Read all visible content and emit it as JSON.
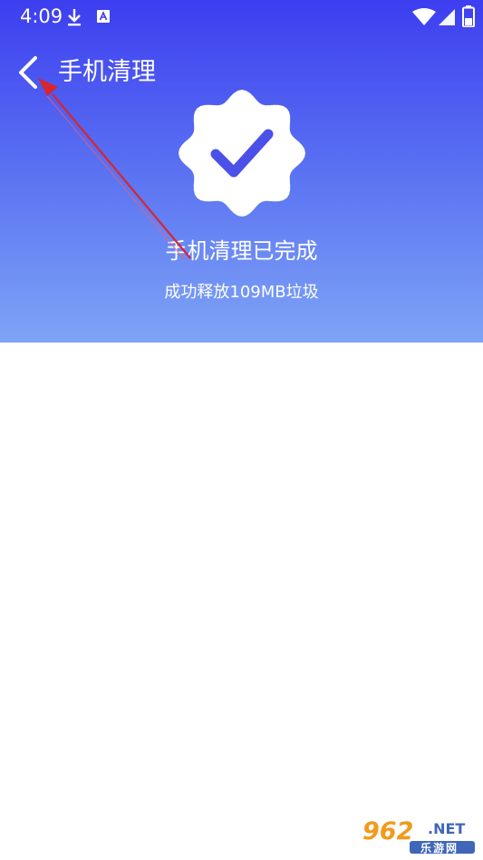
{
  "status_bar": {
    "time": "4:09",
    "icons": [
      "download-icon",
      "a-badge-icon",
      "wifi-icon",
      "signal-icon",
      "battery-icon"
    ]
  },
  "app_bar": {
    "title": "手机清理",
    "back_icon": "chevron-left-icon"
  },
  "result": {
    "badge_icon": "verified-check-badge-icon",
    "title": "手机清理已完成",
    "subtitle": "成功释放109MB垃圾"
  },
  "watermark": {
    "brand": "962",
    "suffix": ".NET",
    "site_name": "乐游网"
  },
  "colors": {
    "header_top": "#3d3ef0",
    "header_bottom": "#7ea4f6",
    "check": "#4a50e8",
    "annotation_arrow": "#d6262f"
  }
}
